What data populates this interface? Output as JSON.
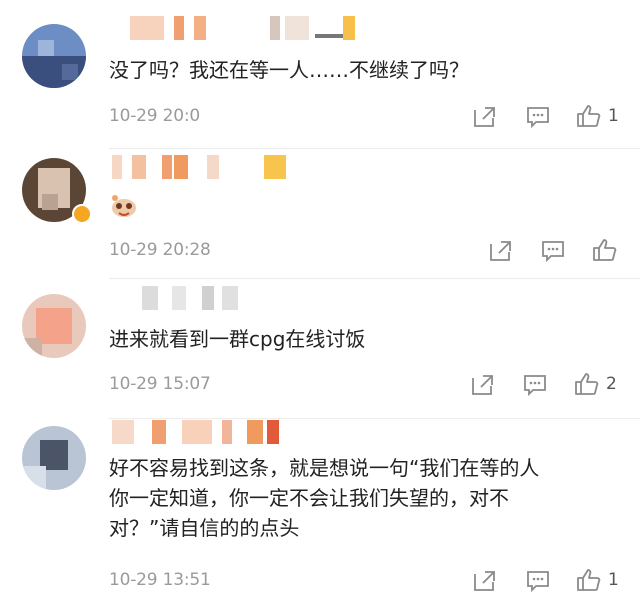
{
  "comments": [
    {
      "text": "没了吗？我还在等一人……不继续了吗？",
      "time": "10-29 20:0",
      "likes": "1"
    },
    {
      "text": "",
      "time": "10-29 20:28",
      "likes": ""
    },
    {
      "text": "进来就看到一群cpg在线讨饭",
      "time": "10-29 15:07",
      "likes": "2"
    },
    {
      "text": "好不容易找到这条，就是想说一句“我们在等的人\n你一定知道，你一定不会让我们失望的，对不\n对？”请自信的的点头",
      "time": "10-29 13:51",
      "likes": "1"
    }
  ],
  "icons": {
    "share": "share-icon",
    "comment": "comment-icon",
    "like": "like-icon",
    "emoji": "emoji-sticker-icon"
  },
  "colors": {
    "text": "#222222",
    "meta": "#9a9a9a",
    "icon": "#8a8a8a",
    "mosaic_accent": "#f3a469"
  }
}
